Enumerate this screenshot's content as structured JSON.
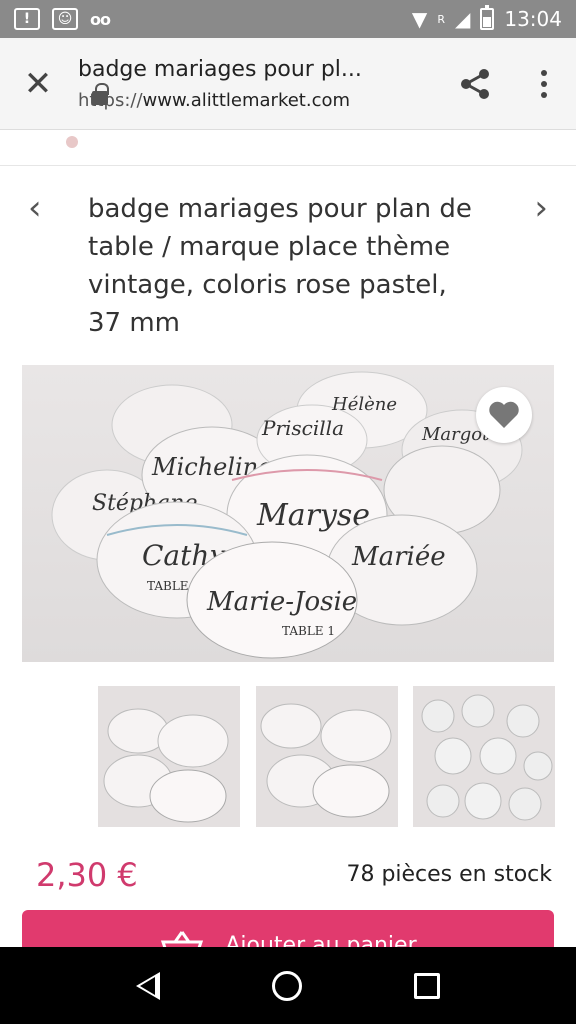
{
  "status_bar": {
    "time": "13:04",
    "signal_label": "R"
  },
  "browser": {
    "page_title": "badge mariages pour pl...",
    "url_scheme": "https://",
    "url_host": "www.alittlemarket.com"
  },
  "product": {
    "title": "badge mariages pour plan de table / marque place thème vintage, coloris rose pastel, 37 mm",
    "price": "2,30 €",
    "stock": "78 pièces en stock",
    "add_to_cart_label": "Ajouter au panier",
    "badge_names": [
      "Micheline",
      "Maryse",
      "Cathy",
      "Marie-Josie",
      "Mariée",
      "Priscilla",
      "Hélène",
      "Margot",
      "Stéphane"
    ],
    "badge_subtitles": [
      "TABLE 1",
      "TABLE D'HONNEUR"
    ],
    "thumbnail_count": 3
  },
  "colors": {
    "accent": "#e13a6e",
    "price": "#d03a6d"
  }
}
